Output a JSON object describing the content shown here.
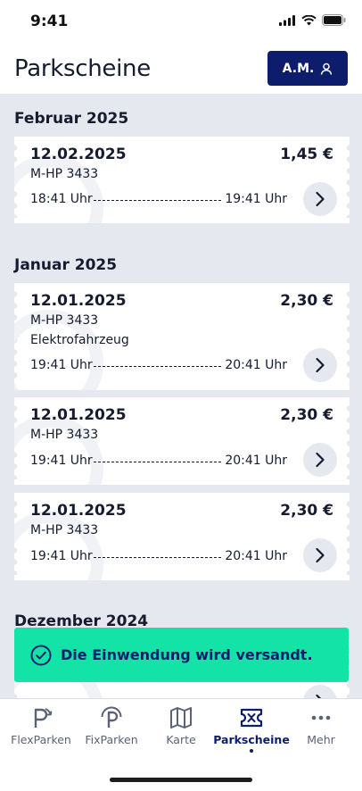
{
  "status": {
    "time": "9:41"
  },
  "header": {
    "title": "Parkscheine",
    "user_initials": "A.M."
  },
  "sections": [
    {
      "month": "Februar 2025",
      "tickets": [
        {
          "date": "12.02.2025",
          "price": "1,45 €",
          "plate": "M-HP 3433",
          "extra": "",
          "start": "18:41 Uhr",
          "end": "19:41 Uhr"
        }
      ]
    },
    {
      "month": "Januar 2025",
      "tickets": [
        {
          "date": "12.01.2025",
          "price": "2,30 €",
          "plate": "M-HP 3433",
          "extra": "Elektrofahrzeug",
          "start": "19:41 Uhr",
          "end": "20:41 Uhr"
        },
        {
          "date": "12.01.2025",
          "price": "2,30 €",
          "plate": "M-HP 3433",
          "extra": "",
          "start": "19:41 Uhr",
          "end": "20:41 Uhr"
        },
        {
          "date": "12.01.2025",
          "price": "2,30 €",
          "plate": "M-HP 3433",
          "extra": "",
          "start": "19:41 Uhr",
          "end": "20:41 Uhr"
        }
      ]
    },
    {
      "month": "Dezember 2024",
      "tickets": []
    }
  ],
  "toast": {
    "message": "Die Einwendung wird versandt.",
    "icon": "check-circle-icon"
  },
  "tabbar": {
    "items": [
      {
        "label": "FlexParken",
        "icon": "flexparken-icon"
      },
      {
        "label": "FixParken",
        "icon": "fixparken-icon"
      },
      {
        "label": "Karte",
        "icon": "map-icon"
      },
      {
        "label": "Parkscheine",
        "icon": "ticket-icon",
        "active": true
      },
      {
        "label": "Mehr",
        "icon": "more-icon"
      }
    ]
  },
  "colors": {
    "primary": "#0d1d6b",
    "background": "#e6e8ef",
    "toast": "#13e3a6",
    "text": "#161b2e"
  }
}
